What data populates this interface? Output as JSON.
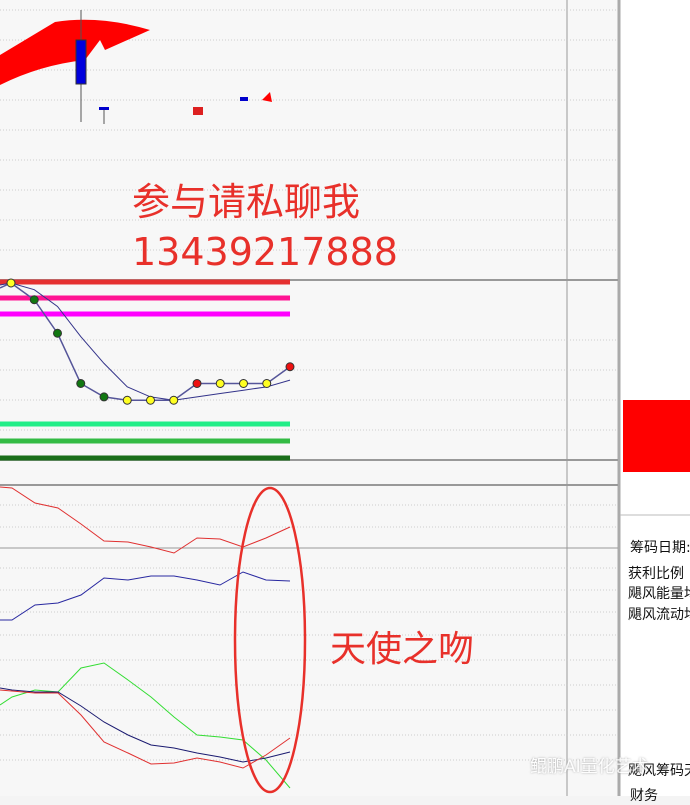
{
  "annotation": {
    "contact_line": "参与请私聊我",
    "phone": "13439217888",
    "oval_label": "天使之吻"
  },
  "side_panel": {
    "chip_date": "筹码日期:",
    "profit_ratio": "获利比例",
    "energy": "飓风能量均",
    "flow": "飓风流动均",
    "chip_title": "飓风筹码天",
    "finance": "财务"
  },
  "watermark": "鲲鹏AI量化艺术",
  "colors": {
    "accent": "#e8302a",
    "up": "#ff0000",
    "down": "#0000cc"
  },
  "indicator": {
    "dots": [
      {
        "v": 100,
        "c": "yellow"
      },
      {
        "v": 95,
        "c": "green"
      },
      {
        "v": 85,
        "c": "green"
      },
      {
        "v": 70,
        "c": "green"
      },
      {
        "v": 66,
        "c": "green"
      },
      {
        "v": 65,
        "c": "yellow"
      },
      {
        "v": 65,
        "c": "yellow"
      },
      {
        "v": 65,
        "c": "yellow"
      },
      {
        "v": 70,
        "c": "red"
      },
      {
        "v": 70,
        "c": "yellow"
      },
      {
        "v": 70,
        "c": "yellow"
      },
      {
        "v": 70,
        "c": "yellow"
      },
      {
        "v": 75,
        "c": "red"
      }
    ],
    "ma": [
      100,
      98,
      93,
      84,
      76,
      69,
      66,
      65,
      66,
      67,
      68,
      69,
      71
    ]
  }
}
